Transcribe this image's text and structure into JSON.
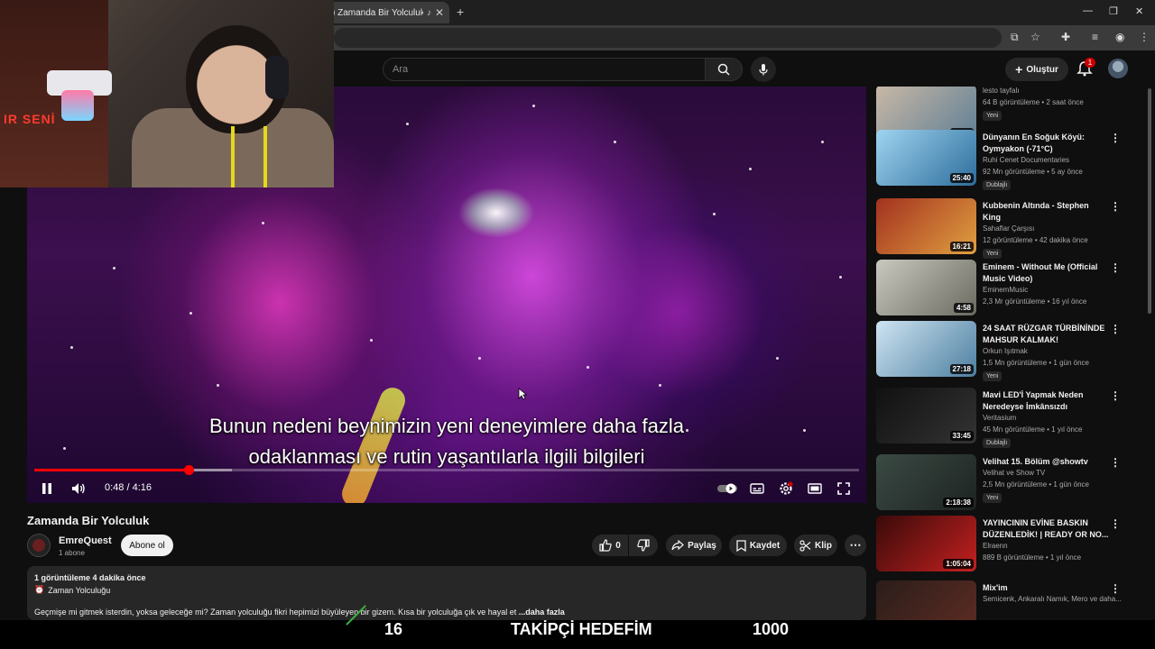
{
  "browser": {
    "tab_title": ") Zamanda Bir Yolculuk - ",
    "new_tab": "+"
  },
  "header": {
    "search_placeholder": "Ara",
    "create_label": "Oluştur",
    "notification_count": "1"
  },
  "player": {
    "subtitle_line1": "Bunun nedeni beynimizin yeni deneyimlere daha fazla",
    "subtitle_line2": "odaklanması ve rutin yaşantılarla ilgili bilgileri",
    "time": "0:48 / 4:16",
    "progress_fraction": 0.1875,
    "buffer_fraction": 0.24
  },
  "video": {
    "title": "Zamanda Bir Yolculuk",
    "channel": "EmreQuest",
    "subscribers": "1 abone",
    "subscribe_label": "Abone ol",
    "likes": "0",
    "share_label": "Paylaş",
    "save_label": "Kaydet",
    "clip_label": "Klip"
  },
  "description": {
    "meta": "1 görüntüleme  4 dakika önce",
    "tag": "Zaman Yolculuğu",
    "text": "Geçmişe mi gitmek isterdin, yoksa geleceğe mi? Zaman yolculuğu fikri hepimizi büyüleyen bir gizem. Kısa bir yolculuğa çık ve hayal et",
    "more": "...daha fazla"
  },
  "sidebar": {
    "items": [
      {
        "title": "",
        "channel": "lesto tayfalı",
        "meta": "64 B görüntüleme • 2 saat önce",
        "badge": "Yeni",
        "duration": "28:04"
      },
      {
        "title": "Dünyanın En Soğuk Köyü: Oymyakon (-71°C)",
        "channel": "Ruhi Cenet Documentaries",
        "meta": "92 Mn görüntüleme • 5 ay önce",
        "badge": "Dublajlı",
        "duration": "25:40"
      },
      {
        "title": "Kubbenin Altında - Stephen King",
        "channel": "Sahaflar Çarşısı",
        "meta": "12 görüntüleme • 42 dakika önce",
        "badge": "Yeni",
        "duration": "16:21"
      },
      {
        "title": "Eminem - Without Me (Official Music Video)",
        "channel": "EminemMusic",
        "meta": "2,3 Mr görüntüleme • 16 yıl önce",
        "badge": "",
        "duration": "4:58"
      },
      {
        "title": "24 SAAT RÜZGAR TÜRBİNİNDE MAHSUR KALMAK!",
        "channel": "Orkun Işıtmak",
        "meta": "1,5 Mn görüntüleme • 1 gün önce",
        "badge": "Yeni",
        "duration": "27:18"
      },
      {
        "title": "Mavi LED'İ Yapmak Neden Neredeyse İmkânsızdı",
        "channel": "Veritasium",
        "meta": "45 Mn görüntüleme • 1 yıl önce",
        "badge": "Dublajlı",
        "duration": "33:45"
      },
      {
        "title": "Velihat 15. Bölüm @showtv",
        "channel": "Velihat ve Show TV",
        "meta": "2,5 Mn görüntüleme • 1 gün önce",
        "badge": "Yeni",
        "duration": "2:18:38"
      },
      {
        "title": "YAYINCININ EVİNE BASKIN DÜZENLEDİK! | READY OR NO...",
        "channel": "Elraenn",
        "meta": "889 B görüntüleme • 1 yıl önce",
        "badge": "",
        "duration": "1:05:04"
      },
      {
        "title": "Mix'im",
        "channel": "Semicenk, Ankaralı Namık, Mero ve daha...",
        "meta": "",
        "badge": "",
        "duration": ""
      }
    ]
  },
  "webcam": {
    "neon_text": "IR SENİ"
  },
  "overlay": {
    "count": "16",
    "label": "TAKİPÇİ HEDEFİM",
    "goal": "1000"
  },
  "colors": {
    "accent": "#ff0000",
    "background": "#0f0f0f",
    "chip": "#272727"
  }
}
